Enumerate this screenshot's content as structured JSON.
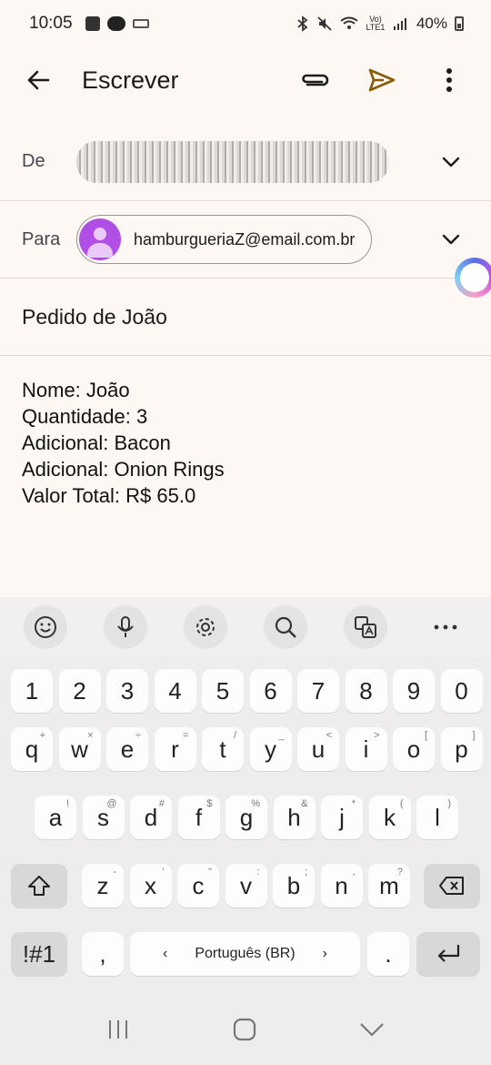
{
  "status_bar": {
    "time": "10:05",
    "net_label": "Vo) LTE1",
    "battery": "40%"
  },
  "app_bar": {
    "title": "Escrever"
  },
  "compose": {
    "from_label": "De",
    "to_label": "Para",
    "to_chip": "hamburgueriaZ@email.com.br",
    "subject": "Pedido de João",
    "body_lines": [
      "Nome: João",
      "Quantidade: 3",
      "Adicional: Bacon",
      "Adicional: Onion Rings",
      "Valor Total: R$ 65.0"
    ]
  },
  "keyboard": {
    "toolbar": [
      "emoji-icon",
      "mic-icon",
      "settings-icon",
      "search-icon",
      "translate-icon",
      "more-icon"
    ],
    "row_numbers": [
      "1",
      "2",
      "3",
      "4",
      "5",
      "6",
      "7",
      "8",
      "9",
      "0"
    ],
    "row1": [
      {
        "k": "q",
        "s": "+"
      },
      {
        "k": "w",
        "s": "×"
      },
      {
        "k": "e",
        "s": "÷"
      },
      {
        "k": "r",
        "s": "="
      },
      {
        "k": "t",
        "s": "/"
      },
      {
        "k": "y",
        "s": "_"
      },
      {
        "k": "u",
        "s": "<"
      },
      {
        "k": "i",
        "s": ">"
      },
      {
        "k": "o",
        "s": "["
      },
      {
        "k": "p",
        "s": "]"
      }
    ],
    "row2": [
      {
        "k": "a",
        "s": "!"
      },
      {
        "k": "s",
        "s": "@"
      },
      {
        "k": "d",
        "s": "#"
      },
      {
        "k": "f",
        "s": "$"
      },
      {
        "k": "g",
        "s": "%"
      },
      {
        "k": "h",
        "s": "&"
      },
      {
        "k": "j",
        "s": "*"
      },
      {
        "k": "k",
        "s": "("
      },
      {
        "k": "l",
        "s": ")"
      }
    ],
    "row3": [
      {
        "k": "z",
        "s": "-"
      },
      {
        "k": "x",
        "s": "'"
      },
      {
        "k": "c",
        "s": "\""
      },
      {
        "k": "v",
        "s": ":"
      },
      {
        "k": "b",
        "s": ";"
      },
      {
        "k": "n",
        "s": ","
      },
      {
        "k": "m",
        "s": "?"
      }
    ],
    "symbols_key": "!#1",
    "comma_key": ",",
    "language": "Português (BR)",
    "period_key": "."
  },
  "colors": {
    "send_accent": "#8a5a00",
    "chip_avatar": "#b04ee6",
    "background": "#fdf8f4"
  }
}
